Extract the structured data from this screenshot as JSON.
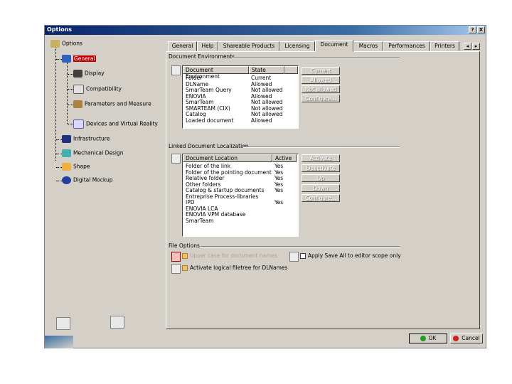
{
  "window": {
    "title": "Options",
    "help_btn": "?",
    "close_btn": "X"
  },
  "tree": {
    "root": "Options",
    "items": [
      {
        "label": "General"
      },
      {
        "label": "Display"
      },
      {
        "label": "Compatibility"
      },
      {
        "label": "Parameters and Measure"
      },
      {
        "label": "Devices and Virtual Reality"
      },
      {
        "label": "Infrastructure"
      },
      {
        "label": "Mechanical Design"
      },
      {
        "label": "Shape"
      },
      {
        "label": "Digital Mockup"
      }
    ]
  },
  "tabs": [
    "General",
    "Help",
    "Shareable Products",
    "Licensing",
    "Document",
    "Macros",
    "Performances",
    "Printers"
  ],
  "tab_scroll": {
    "left": "◂",
    "right": "▸"
  },
  "doc_env": {
    "title": "Document Environments",
    "headers": [
      "Document Environment",
      "State"
    ],
    "rows": [
      [
        "Folder",
        "Current"
      ],
      [
        "DLName",
        "Allowed"
      ],
      [
        "SmarTeam Query",
        "Not allowed"
      ],
      [
        "ENOVIA",
        "Allowed"
      ],
      [
        "SmarTeam",
        "Not allowed"
      ],
      [
        "SMARTEAM (CIX)",
        "Not allowed"
      ],
      [
        "Catalog",
        "Not allowed"
      ],
      [
        "Loaded document",
        "Allowed"
      ]
    ],
    "buttons": [
      "Current",
      "Allowed",
      "Not allowed",
      "Configure..."
    ]
  },
  "linked_doc": {
    "title": "Linked Document Localization",
    "headers": [
      "Document Location",
      "Active"
    ],
    "rows": [
      [
        "Folder of the link",
        "Yes"
      ],
      [
        "Folder of the pointing document",
        "Yes"
      ],
      [
        "Relative folder",
        "Yes"
      ],
      [
        "Other folders",
        "Yes"
      ],
      [
        "Catalog & startup documents",
        "Yes"
      ],
      [
        "Entreprise Process-libraries",
        ""
      ],
      [
        "IPD",
        "Yes"
      ],
      [
        "ENOVIA LCA",
        ""
      ],
      [
        "ENOVIA VPM  database",
        ""
      ],
      [
        "SmarTeam",
        ""
      ]
    ],
    "buttons": [
      "Activate",
      "Deactivate",
      "Up",
      "Down",
      "Configure..."
    ]
  },
  "file_options": {
    "title": "File Options",
    "upper_case": "Upper case for document names",
    "apply_save": "Apply Save All to editor scope only",
    "logical_filetree": "Activate logical filetree for DLNames"
  },
  "footer": {
    "ok": "OK",
    "cancel": "Cancel"
  },
  "colors": {
    "title_start": "#0a246a",
    "selected": "#c00000",
    "ok_dot": "#20a020",
    "cancel_dot": "#d02020"
  }
}
